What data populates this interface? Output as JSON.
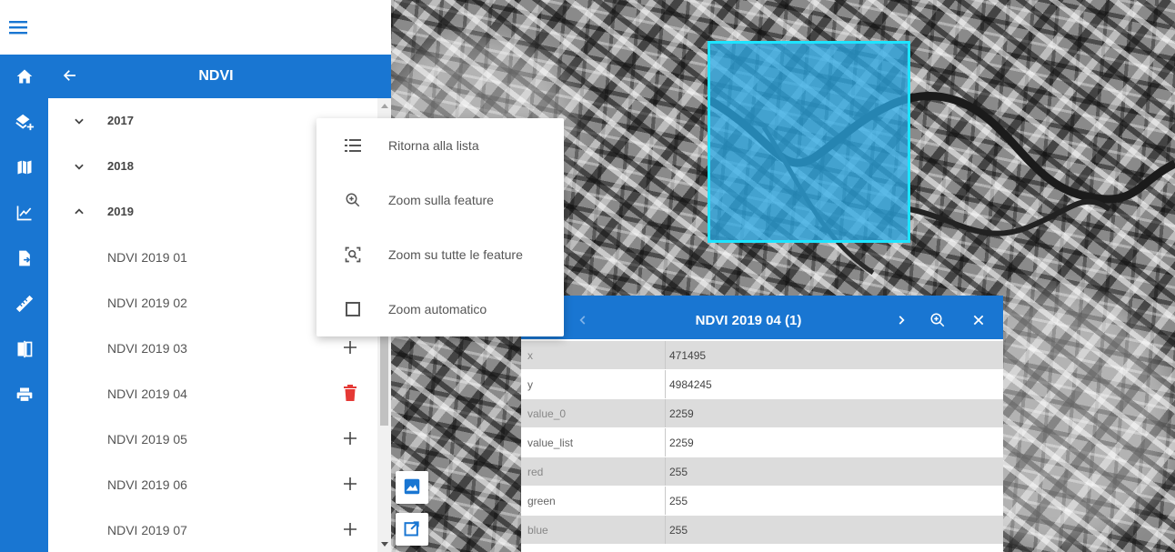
{
  "app": {
    "menu_icon": "hamburger-menu-icon"
  },
  "rail": {
    "items": [
      {
        "icon": "home-icon"
      },
      {
        "icon": "add-layer-icon"
      },
      {
        "icon": "map-icon"
      },
      {
        "icon": "chart-icon"
      },
      {
        "icon": "export-file-icon"
      },
      {
        "icon": "ruler-icon"
      },
      {
        "icon": "compare-icon"
      },
      {
        "icon": "print-icon"
      }
    ]
  },
  "panel": {
    "title": "NDVI",
    "back_icon": "arrow-back-icon",
    "groups": [
      {
        "year": "2017",
        "expanded": false
      },
      {
        "year": "2018",
        "expanded": false
      },
      {
        "year": "2019",
        "expanded": true
      }
    ],
    "items": [
      {
        "label": "NDVI 2019 01",
        "action": "add"
      },
      {
        "label": "NDVI 2019 02",
        "action": "add"
      },
      {
        "label": "NDVI 2019 03",
        "action": "add"
      },
      {
        "label": "NDVI 2019 04",
        "action": "delete"
      },
      {
        "label": "NDVI 2019 05",
        "action": "add"
      },
      {
        "label": "NDVI 2019 06",
        "action": "add"
      },
      {
        "label": "NDVI 2019 07",
        "action": "add"
      }
    ]
  },
  "context_menu": {
    "items": [
      {
        "label": "Ritorna alla lista",
        "icon": "list-icon"
      },
      {
        "label": "Zoom sulla feature",
        "icon": "zoom-in-icon"
      },
      {
        "label": "Zoom su tutte le feature",
        "icon": "zoom-all-icon"
      },
      {
        "label": "Zoom automatico",
        "icon": "checkbox-icon",
        "checked": false
      }
    ]
  },
  "popup": {
    "title": "NDVI 2019 04 (1)",
    "rows": [
      {
        "key": "x",
        "value": "471495"
      },
      {
        "key": "y",
        "value": "4984245"
      },
      {
        "key": "value_0",
        "value": "2259"
      },
      {
        "key": "value_list",
        "value": "2259"
      },
      {
        "key": "red",
        "value": "255"
      },
      {
        "key": "green",
        "value": "255"
      },
      {
        "key": "blue",
        "value": "255"
      }
    ]
  },
  "colors": {
    "primary": "#1976d2",
    "highlight_border": "#1ee3ff",
    "delete": "#e53935"
  }
}
